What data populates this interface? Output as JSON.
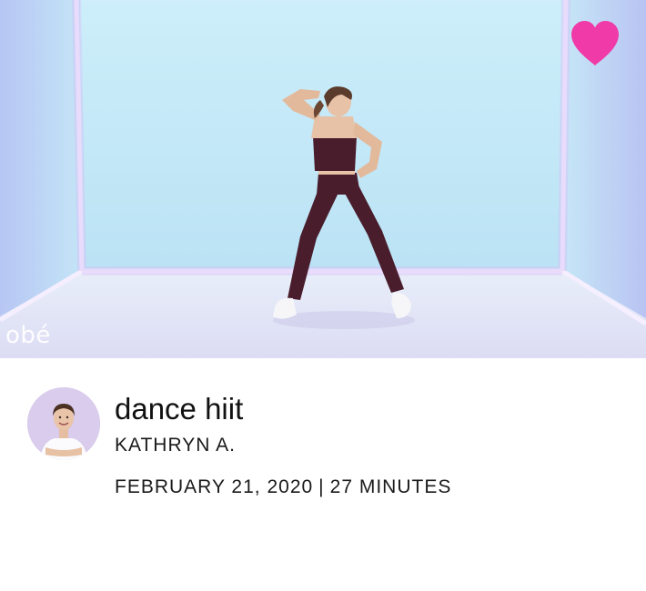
{
  "video": {
    "brand": "obé",
    "favorite_icon": "heart-icon",
    "favorite_color": "#ef3aa7",
    "favorited": true
  },
  "workout": {
    "title": "dance hiit",
    "instructor": "KATHRYN A.",
    "date": "FEBRUARY 21, 2020",
    "separator": "|",
    "duration": "27 MINUTES"
  },
  "colors": {
    "backdrop_top": "#cfeaf7",
    "backdrop_side": "#b9c9f3",
    "neon_edge": "#f4ecff",
    "outfit": "#4a1d2c"
  }
}
